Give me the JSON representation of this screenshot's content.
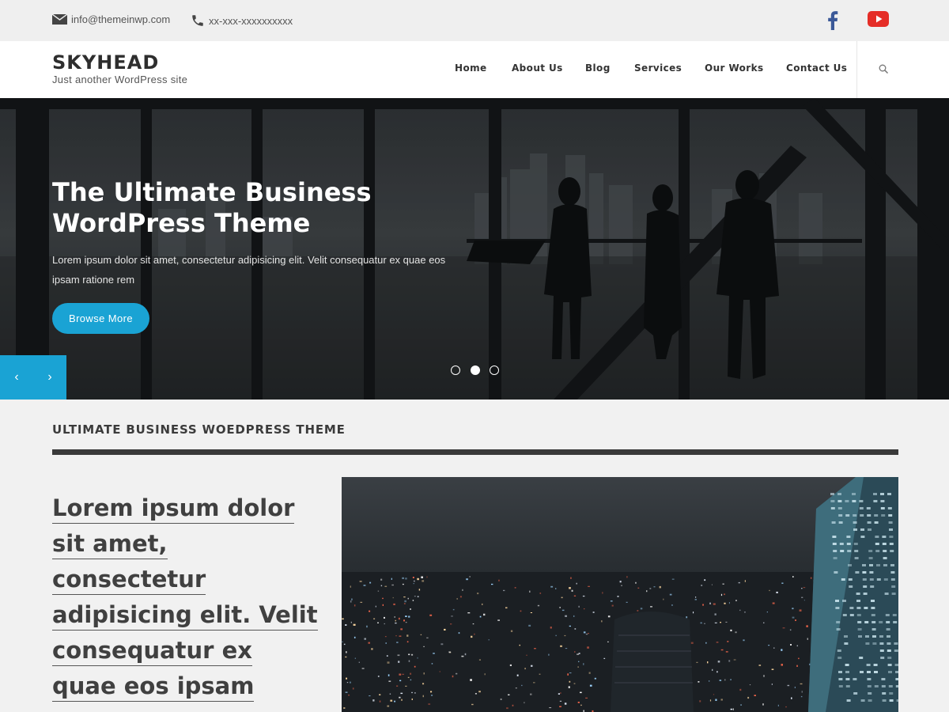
{
  "topbar": {
    "email": "info@themeinwp.com",
    "phone": "xx-xxx-xxxxxxxxxx",
    "icons": [
      "mail-icon",
      "phone-icon",
      "facebook-icon",
      "youtube-icon"
    ]
  },
  "header": {
    "site_title": "SKYHEAD",
    "tagline": "Just another WordPress site"
  },
  "nav": {
    "items": [
      {
        "label": "Home"
      },
      {
        "label": "About Us"
      },
      {
        "label": "Blog"
      },
      {
        "label": "Services"
      },
      {
        "label": "Our Works"
      },
      {
        "label": "Contact Us"
      }
    ]
  },
  "hero": {
    "title": "The Ultimate Business WordPress Theme",
    "description": "Lorem ipsum dolor sit amet, consectetur adipisicing elit. Velit consequatur ex quae eos ipsam ratione rem",
    "button_label": "Browse More",
    "prev_label": "‹",
    "next_label": "›",
    "active_slide": 2,
    "slide_count": 3
  },
  "section": {
    "title": "ULTIMATE BUSINESS WOEDPRESS THEME",
    "lines": [
      "Lorem ipsum dolor",
      "sit amet,",
      "consectetur",
      "adipisicing elit. Velit",
      "consequatur ex",
      "quae eos ipsam"
    ]
  },
  "colors": {
    "accent": "#1aa3d4",
    "facebook": "#3b5998",
    "youtube": "#e52d27",
    "dark_text": "#2e2e2e"
  }
}
